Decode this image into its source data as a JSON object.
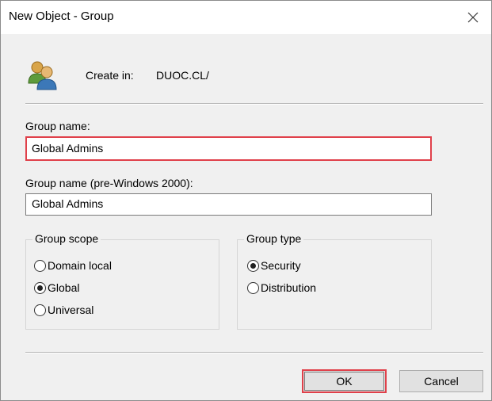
{
  "window": {
    "title": "New Object - Group",
    "close_glyph": "✕"
  },
  "create_in": {
    "label": "Create in:",
    "value": "DUOC.CL/"
  },
  "group_name": {
    "label": "Group name:",
    "value": "Global Admins"
  },
  "group_name_pre2000": {
    "label": "Group name (pre-Windows 2000):",
    "value": "Global Admins"
  },
  "group_scope": {
    "legend": "Group scope",
    "options": [
      {
        "label": "Domain local",
        "checked": false
      },
      {
        "label": "Global",
        "checked": true
      },
      {
        "label": "Universal",
        "checked": false
      }
    ]
  },
  "group_type": {
    "legend": "Group type",
    "options": [
      {
        "label": "Security",
        "checked": true
      },
      {
        "label": "Distribution",
        "checked": false
      }
    ]
  },
  "buttons": {
    "ok": "OK",
    "cancel": "Cancel"
  },
  "colors": {
    "highlight": "#e0404a",
    "background": "#f0f0f0"
  },
  "icons": {
    "header": "users-icon",
    "close": "close-icon"
  }
}
